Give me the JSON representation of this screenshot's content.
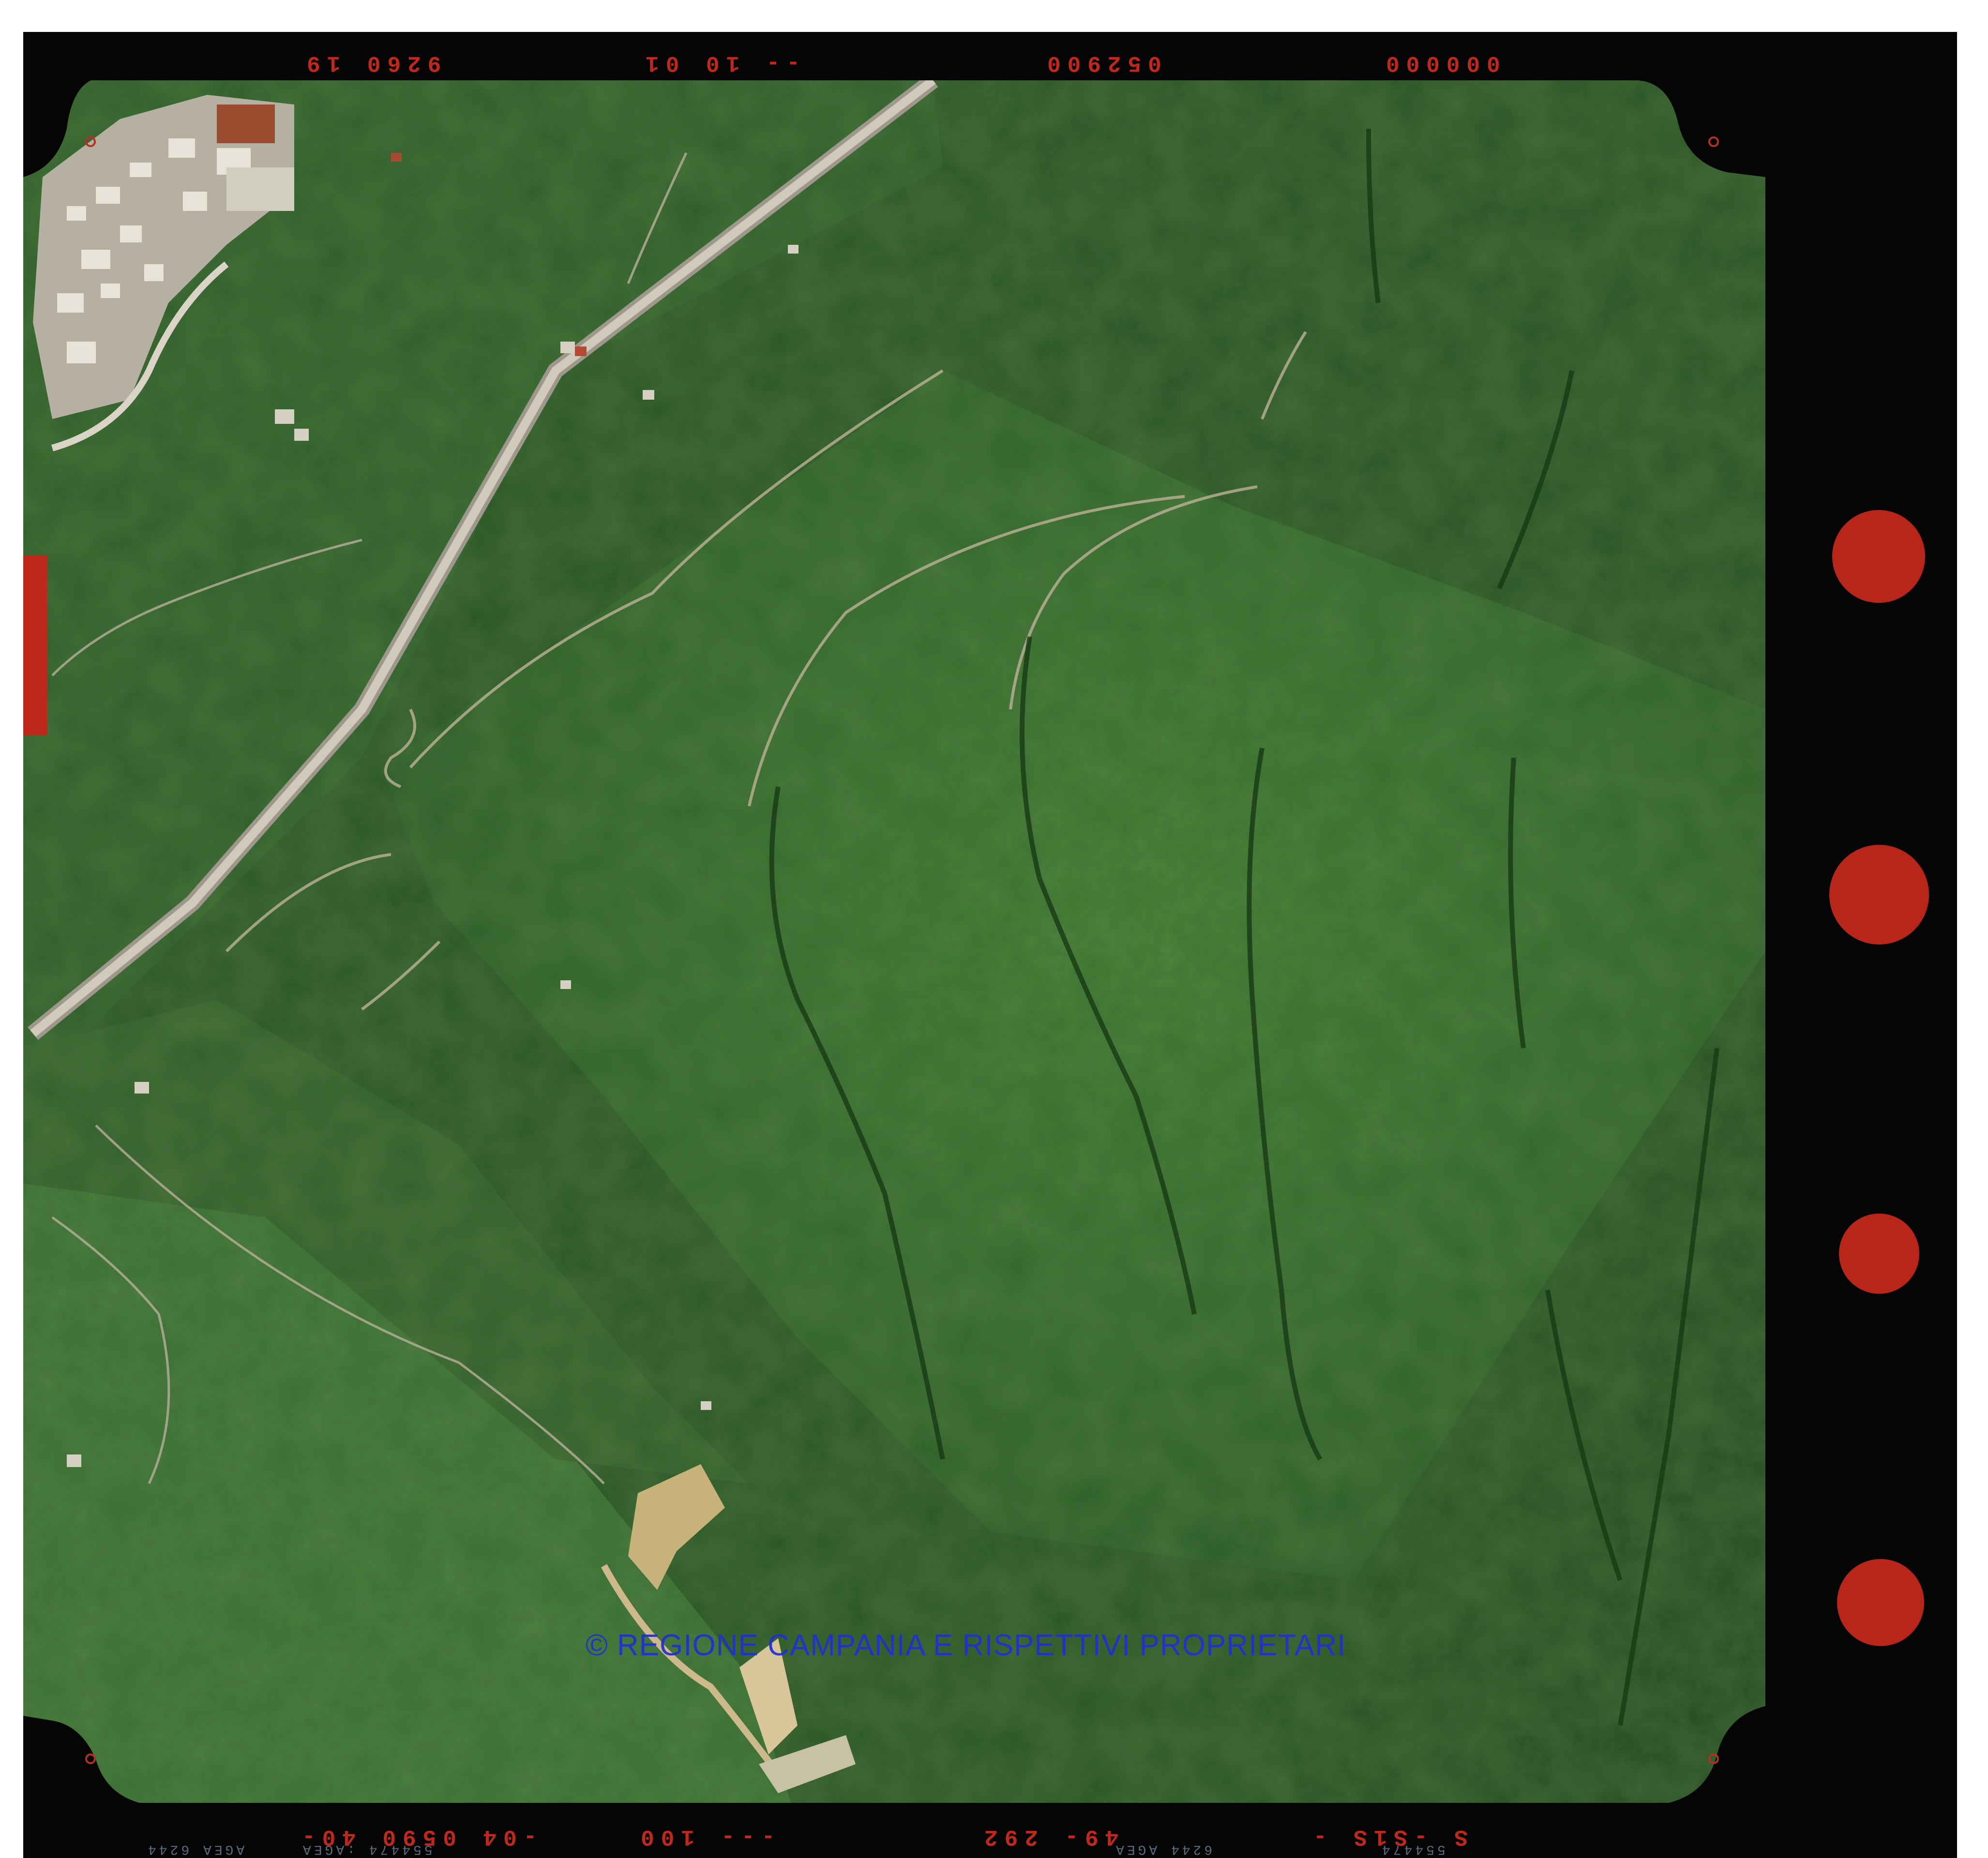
{
  "photo": {
    "description_colors": {
      "film_border": "#050505",
      "forest_dark": "#1f4a1c",
      "forest_light": "#3d7a2c",
      "road": "#b9b4a6",
      "annotation_red": "#c0281c",
      "watermark_blue": "#1f2fd6"
    }
  },
  "header_codes": {
    "code_1": "9260 19",
    "code_2": "-- 10 01",
    "code_3": "052900",
    "code_4": "000000"
  },
  "footer_codes": {
    "code_1": "-04 0590 40-",
    "code_2": "--- 100",
    "code_3": "49- 292",
    "code_4": "S -S1S -",
    "small_1": "AGEA 6244",
    "small_2": "554474 :AGEA",
    "small_3": "6244 AGEA",
    "small_4": "554474"
  },
  "watermark": "© REGIONE CAMPANIA E RISPETTIVI PROPRIETARI"
}
